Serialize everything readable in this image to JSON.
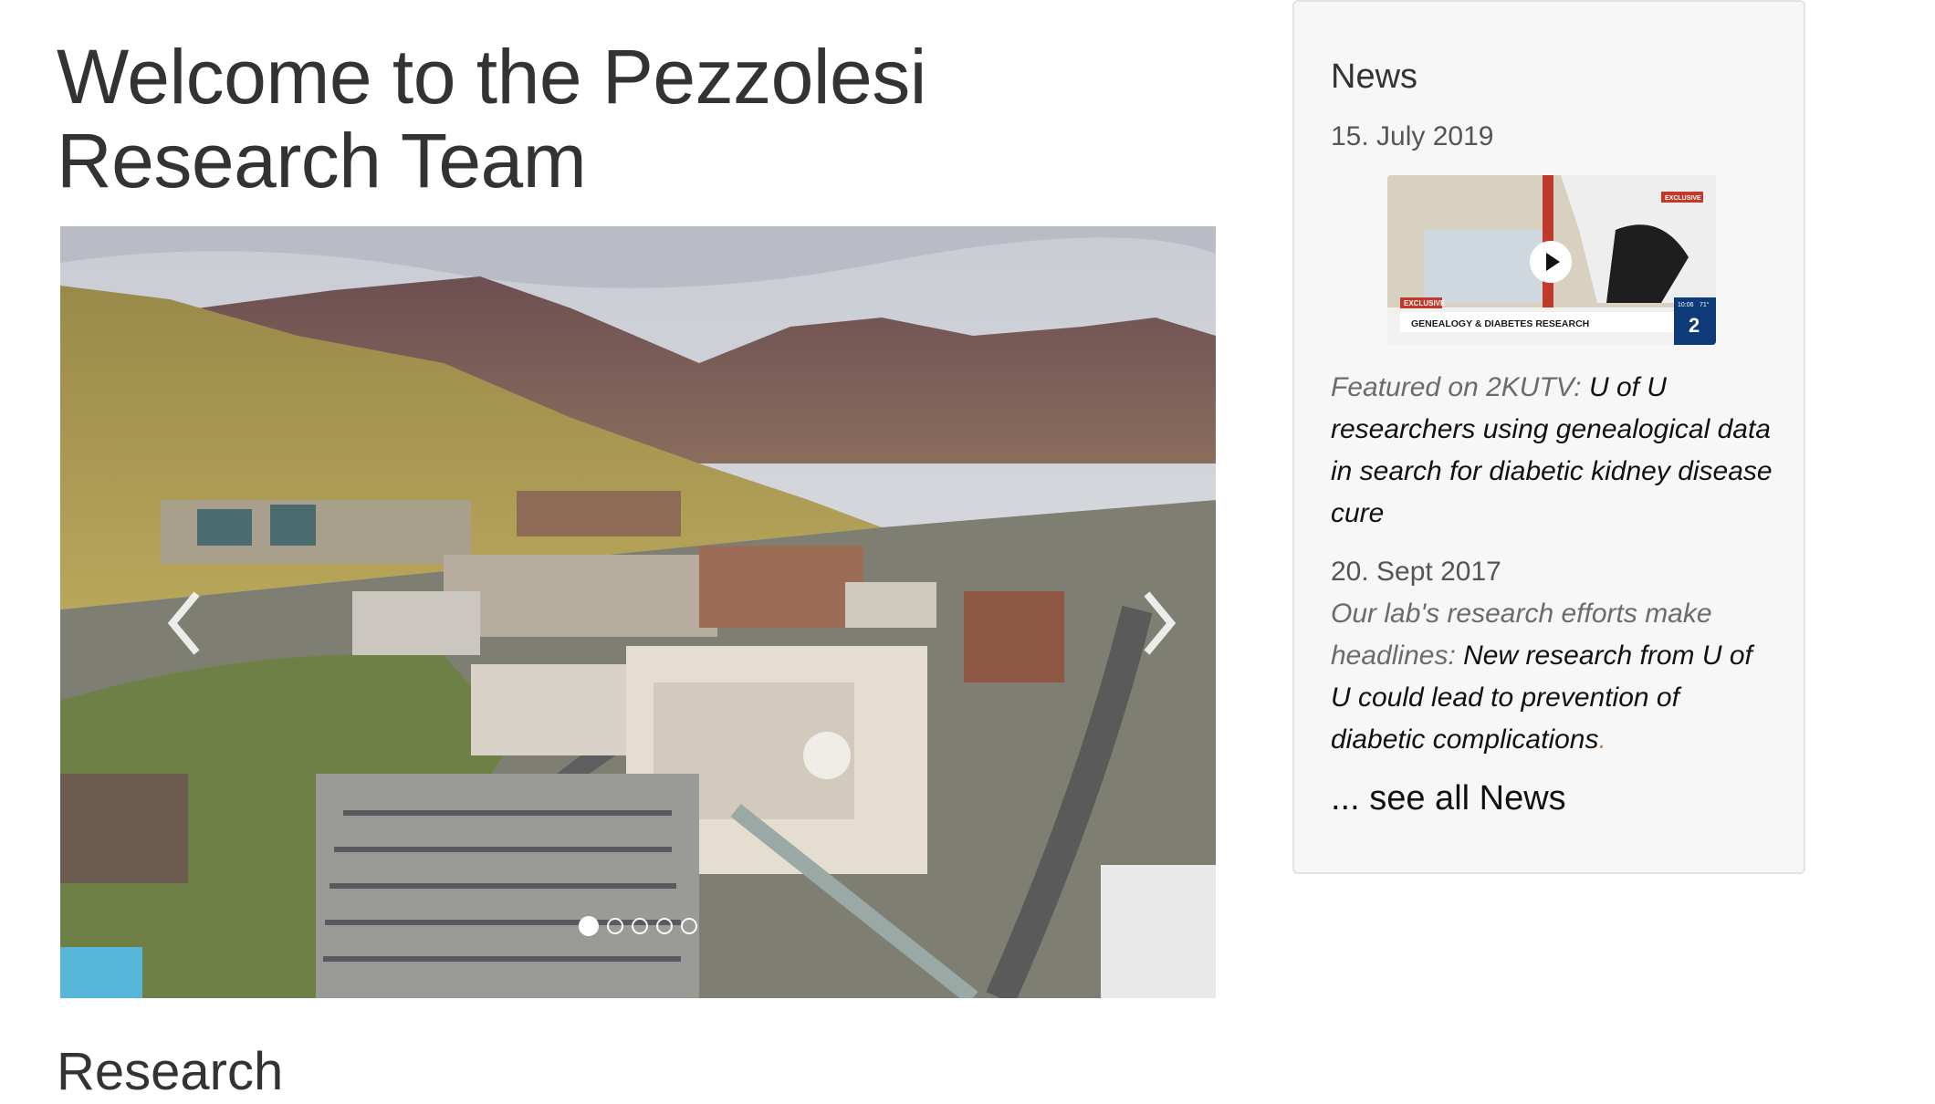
{
  "page": {
    "title": "Welcome to the Pezzolesi Research Team",
    "section_heading": "Research"
  },
  "carousel": {
    "image_description": "aerial-campus-view",
    "prev_icon": "chevron-left-icon",
    "next_icon": "chevron-right-icon",
    "slide_count": 5,
    "active_index": 0
  },
  "news": {
    "title": "News",
    "items": [
      {
        "date": "15. July 2019",
        "thumbnail": {
          "badge": "EXCLUSIVE",
          "caption": "GENEALOGY & DIABETES RESEARCH",
          "small_badge": "EXCLUSIVE",
          "channel": "2",
          "time": "10:06",
          "temp": "71°",
          "play_icon": "play-icon"
        },
        "lead": "Featured on 2KUTV:",
        "link": "U of U researchers using genealogical data in search for diabetic kidney disease cure"
      },
      {
        "date": "20. Sept 2017",
        "lead": "Our lab's research efforts make headlines:",
        "link": "New research from U of U could lead to prevention of diabetic complications",
        "end": "."
      }
    ],
    "see_all": "... see all News"
  },
  "colors": {
    "panel_bg": "#f7f7f7",
    "panel_border": "#e3e3e3",
    "text": "#333333",
    "muted": "#6b6b6b"
  }
}
